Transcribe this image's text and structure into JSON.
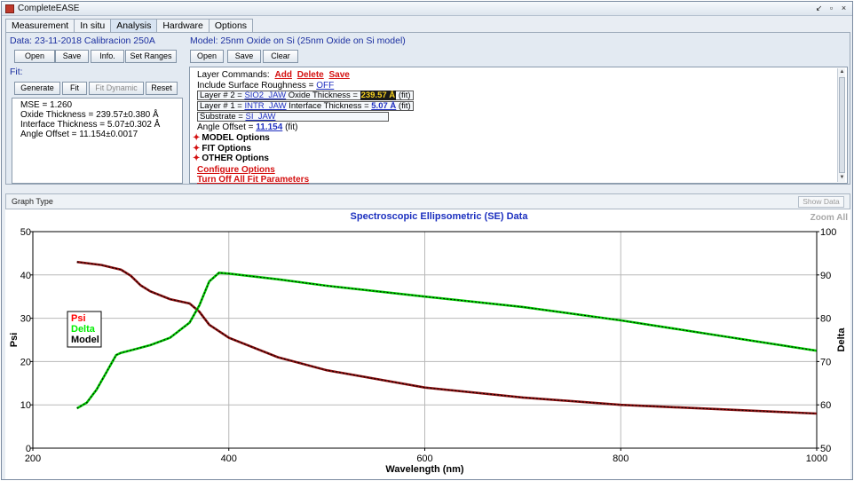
{
  "window": {
    "title": "CompleteEASE",
    "controls": [
      "↙",
      "▫",
      "×"
    ]
  },
  "tabs": [
    "Measurement",
    "In situ",
    "Analysis",
    "Hardware",
    "Options"
  ],
  "data_panel": {
    "title": "Data: 23-11-2018 Calibracion 250A",
    "buttons": [
      "Open",
      "Save",
      "Info.",
      "Set Ranges"
    ]
  },
  "fit_panel": {
    "title": "Fit:",
    "buttons": [
      "Generate",
      "Fit",
      "Fit Dynamic",
      "Reset"
    ],
    "results": [
      "MSE = 1.260",
      "Oxide Thickness = 239.57±0.380 Å",
      "Interface Thickness = 5.07±0.302 Å",
      "Angle Offset = 11.154±0.0017"
    ]
  },
  "model_panel": {
    "title": "Model: 25nm Oxide on Si (25nm Oxide on Si model)",
    "buttons": [
      "Open",
      "Save",
      "Clear"
    ],
    "layer_commands_label": "Layer Commands:",
    "layer_commands": [
      "Add",
      "Delete",
      "Save"
    ],
    "roughness_label": "Include Surface Roughness =",
    "roughness_value": "OFF",
    "layer2": {
      "prefix": "Layer # 2 =",
      "material": "SIO2_JAW",
      "param": "Oxide Thickness =",
      "value": "239.57 Å",
      "suffix": "(fit)"
    },
    "layer1": {
      "prefix": "Layer # 1 =",
      "material": "INTR_JAW",
      "param": "Interface Thickness =",
      "value": "5.07 Å",
      "suffix": "(fit)"
    },
    "substrate_label": "Substrate =",
    "substrate_value": "SI_JAW",
    "angle_label": "Angle Offset =",
    "angle_value": "11.154",
    "angle_suffix": "(fit)",
    "options": [
      "MODEL Options",
      "FIT Options",
      "OTHER Options"
    ],
    "links": [
      "Configure Options",
      "Turn Off All Fit Parameters"
    ]
  },
  "graph_bar": {
    "label": "Graph Type",
    "show_data": "Show Data"
  },
  "chart_data": {
    "type": "line",
    "title": "Spectroscopic Ellipsometric (SE) Data",
    "zoom_label": "Zoom All",
    "xlabel": "Wavelength (nm)",
    "ylabel": "Psi",
    "y2label": "Delta",
    "xlim": [
      200,
      1000
    ],
    "ylim": [
      0,
      50
    ],
    "y2lim": [
      50,
      100
    ],
    "xticks": [
      200,
      400,
      600,
      800,
      1000
    ],
    "yticks": [
      0,
      10,
      20,
      30,
      40,
      50
    ],
    "y2ticks": [
      50,
      60,
      70,
      80,
      90,
      100
    ],
    "grid": true,
    "legend": [
      {
        "name": "Psi",
        "color": "#ff0000"
      },
      {
        "name": "Delta",
        "color": "#00ee00"
      },
      {
        "name": "Model",
        "color": "#000000"
      }
    ],
    "series": [
      {
        "name": "Psi",
        "axis": "left",
        "color": "#8b1010",
        "x": [
          245,
          270,
          290,
          300,
          310,
          320,
          340,
          360,
          370,
          380,
          400,
          450,
          500,
          600,
          700,
          800,
          900,
          1000
        ],
        "y": [
          43.0,
          42.3,
          41.2,
          39.8,
          37.6,
          36.2,
          34.4,
          33.4,
          31.5,
          28.5,
          25.5,
          21.0,
          18.0,
          14.0,
          11.7,
          10.0,
          9.0,
          8.0
        ]
      },
      {
        "name": "Delta",
        "axis": "right",
        "color": "#00cc00",
        "x": [
          245,
          255,
          265,
          275,
          285,
          290,
          300,
          320,
          340,
          360,
          370,
          380,
          390,
          400,
          450,
          500,
          600,
          700,
          800,
          900,
          1000
        ],
        "y": [
          59.2,
          60.5,
          63.5,
          67.5,
          71.5,
          72.0,
          72.6,
          73.8,
          75.5,
          79.0,
          83.0,
          88.5,
          90.5,
          90.3,
          89.0,
          87.5,
          85.0,
          82.6,
          79.5,
          76.0,
          72.5
        ]
      }
    ]
  }
}
